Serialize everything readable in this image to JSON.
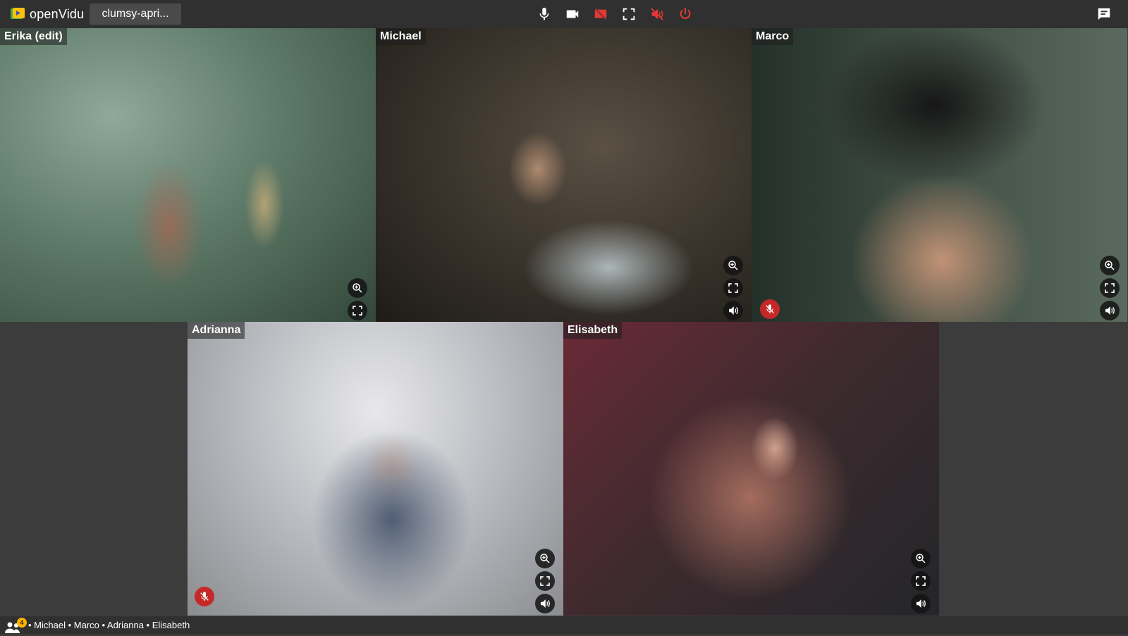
{
  "toolbar": {
    "app_name": "openVidu",
    "session_name": "clumsy-apri...",
    "icons": [
      "mic-icon",
      "videocam-icon",
      "screenshare-off-icon",
      "fullscreen-icon",
      "speaker-off-icon",
      "power-icon",
      "chat-icon"
    ],
    "colors": {
      "background": "#303030",
      "danger": "#e53935",
      "accent": "#ffb300"
    }
  },
  "participants": [
    {
      "name": "Erika (edit)",
      "muted": false,
      "volume_control": false
    },
    {
      "name": "Michael",
      "muted": false,
      "volume_control": true
    },
    {
      "name": "Marco",
      "muted": true,
      "volume_control": true
    },
    {
      "name": "Adrianna",
      "muted": true,
      "volume_control": true
    },
    {
      "name": "Elisabeth",
      "muted": false,
      "volume_control": true
    }
  ],
  "footer": {
    "count": "4",
    "names": "• Michael • Marco • Adrianna • Elisabeth"
  }
}
